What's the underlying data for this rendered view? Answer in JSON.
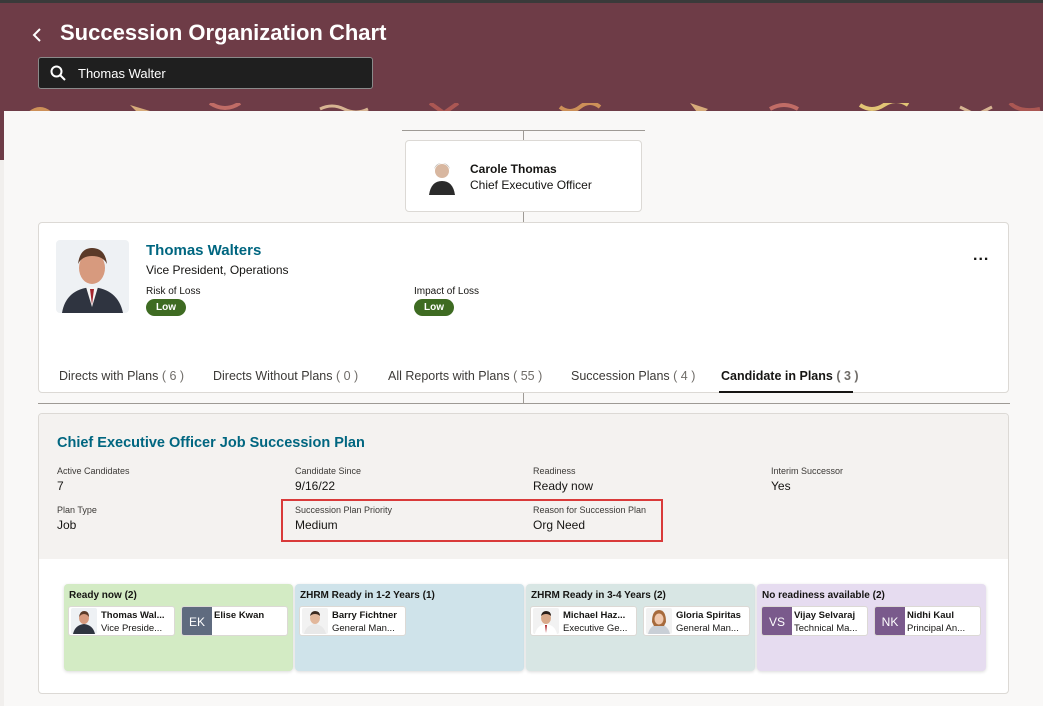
{
  "header": {
    "title": "Succession Organization Chart",
    "search_value": "Thomas Walter"
  },
  "manager": {
    "name": "Carole Thomas",
    "title": "Chief Executive Officer"
  },
  "person": {
    "name": "Thomas Walters",
    "title": "Vice President, Operations",
    "risk_label": "Risk of Loss",
    "risk_value": "Low",
    "impact_label": "Impact of Loss",
    "impact_value": "Low",
    "more": "..."
  },
  "tabs": [
    {
      "label": "Directs with Plans",
      "count": "( 6 )"
    },
    {
      "label": "Directs Without Plans",
      "count": "( 0 )"
    },
    {
      "label": "All Reports with Plans",
      "count": "( 55 )"
    },
    {
      "label": "Succession Plans",
      "count": "( 4 )"
    },
    {
      "label": "Candidate in Plans",
      "count": "( 3 )"
    }
  ],
  "plan": {
    "title": "Chief Executive Officer Job Succession Plan",
    "fields": [
      {
        "label": "Active Candidates",
        "value": "7"
      },
      {
        "label": "Candidate Since",
        "value": "9/16/22"
      },
      {
        "label": "Readiness",
        "value": "Ready now"
      },
      {
        "label": "Interim Successor",
        "value": "Yes"
      },
      {
        "label": "Plan Type",
        "value": "Job"
      },
      {
        "label": "Succession Plan Priority",
        "value": "Medium"
      },
      {
        "label": "Reason for Succession Plan",
        "value": "Org Need"
      }
    ]
  },
  "columns": [
    {
      "title": "Ready now (2)",
      "color": "#d3ebc4",
      "candidates": [
        {
          "name": "Thomas Wal...",
          "role": "Vice Preside...",
          "initials": ""
        },
        {
          "name": "Elise Kwan",
          "role": "",
          "initials": "EK"
        }
      ]
    },
    {
      "title": "ZHRM Ready in 1-2 Years (1)",
      "color": "#cfe3ea",
      "candidates": [
        {
          "name": "Barry Fichtner",
          "role": "General Man...",
          "initials": ""
        }
      ]
    },
    {
      "title": "ZHRM Ready in 3-4 Years (2)",
      "color": "#d8e6e4",
      "candidates": [
        {
          "name": "Michael Haz...",
          "role": "Executive Ge...",
          "initials": ""
        },
        {
          "name": "Gloria Spiritas",
          "role": "General Man...",
          "initials": ""
        }
      ]
    },
    {
      "title": "No readiness available (2)",
      "color": "#e6dcf0",
      "candidates": [
        {
          "name": "Vijay Selvaraj",
          "role": "Technical Ma...",
          "initials": "VS"
        },
        {
          "name": "Nidhi Kaul",
          "role": "Principal An...",
          "initials": "NK"
        }
      ]
    }
  ]
}
